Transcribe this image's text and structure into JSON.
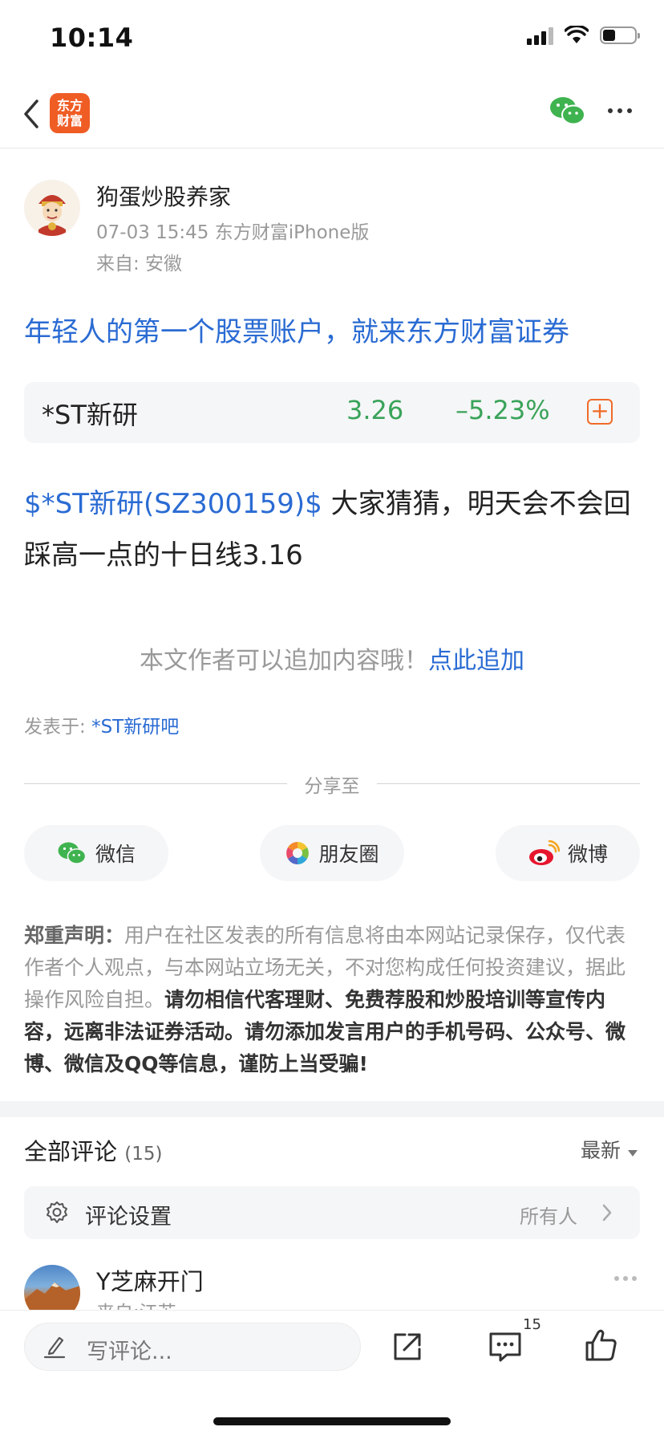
{
  "status_bar": {
    "time": "10:14"
  },
  "nav": {
    "logo_line1": "东方",
    "logo_line2": "财富",
    "back_icon": "chevron-left-icon",
    "wechat_icon": "wechat-icon",
    "more_icon": "more-horizontal-icon"
  },
  "post": {
    "author": "狗蛋炒股养家",
    "meta": "07-03 15:45 东方财富iPhone版",
    "from": "来自: 安徽",
    "ad_link": "年轻人的第一个股票账户，就来东方财富证券",
    "stock": {
      "name": "*ST新研",
      "price": "3.26",
      "change": "–5.23%",
      "add_label": "+"
    },
    "body_tag": "$*ST新研(SZ300159)$",
    "body_text": " 大家猜猜，明天会不会回踩高一点的十日线3.16",
    "append_text": "本文作者可以追加内容哦！",
    "append_link": "点此追加",
    "posted_in_label": "发表于: ",
    "posted_in_link": "*ST新研吧"
  },
  "share": {
    "title": "分享至",
    "buttons": [
      {
        "label": "微信",
        "icon": "wechat-icon"
      },
      {
        "label": "朋友圈",
        "icon": "moments-icon"
      },
      {
        "label": "微博",
        "icon": "weibo-icon"
      }
    ]
  },
  "disclaimer": {
    "head": "郑重声明：",
    "normal": "用户在社区发表的所有信息将由本网站记录保存，仅代表作者个人观点，与本网站立场无关，不对您构成任何投资建议，据此操作风险自担。",
    "bold": "请勿相信代客理财、免费荐股和炒股培训等宣传内容，远离非法证券活动。请勿添加发言用户的手机号码、公众号、微博、微信及QQ等信息，谨防上当受骗!"
  },
  "comments": {
    "title": "全部评论",
    "count": "(15)",
    "sort": "最新",
    "settings_label": "评论设置",
    "settings_value": "所有人",
    "first": {
      "name": "Y芝麻开门",
      "from": "来自:江苏"
    }
  },
  "bottom_bar": {
    "placeholder": "写评论...",
    "comment_count": "15",
    "share_icon": "share-out-icon",
    "comment_icon": "comment-icon",
    "like_icon": "thumbs-up-icon"
  }
}
